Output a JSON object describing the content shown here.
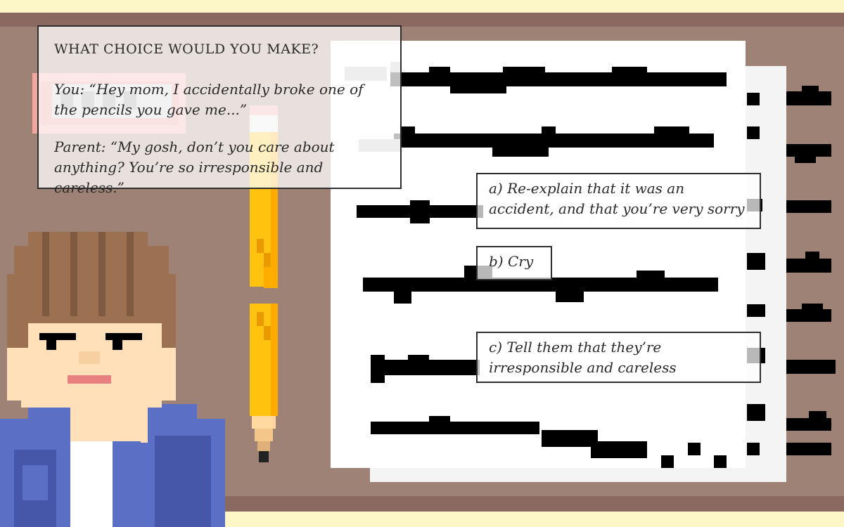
{
  "dialog": {
    "prompt": "WHAT CHOICE WOULD YOU MAKE?",
    "you_line": "You: “Hey mom, I accidentally broke one of the pencils you gave me...”",
    "parent_line": "Parent: “My gosh, don’t you care about anything? You’re so irresponsible and careless.”"
  },
  "choices": [
    {
      "label": "a) Re-explain that it was an accident, and that you’re very sorry"
    },
    {
      "label": "b) Cry"
    },
    {
      "label": "c) Tell them that they’re irresponsible and careless"
    }
  ],
  "colors": {
    "background": "#fdf6c6",
    "desk_wall": "#9e8276",
    "desk_edge": "#8a6a60",
    "paper": "#ffffff",
    "ink": "#000000",
    "pencil_yellow": "#ffc20e",
    "jacket_blue": "#5b6fc4",
    "hair_brown": "#9b7152",
    "skin": "#ffe0b8"
  }
}
